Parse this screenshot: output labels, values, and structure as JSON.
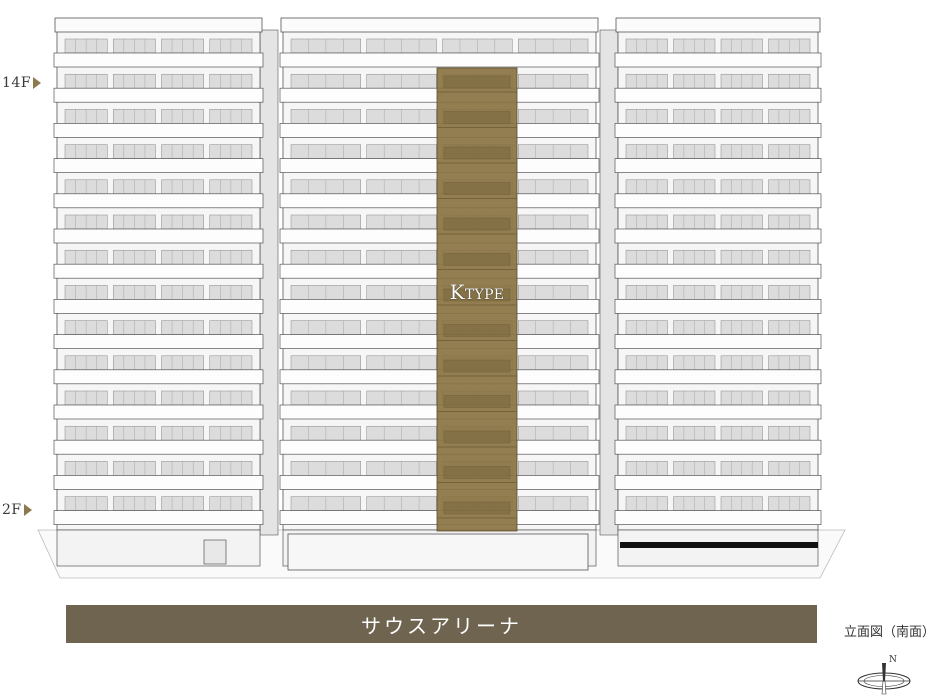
{
  "floor_labels": {
    "top": "14F",
    "bottom": "2F"
  },
  "unit_label": {
    "initial": "K",
    "rest": "TYPE"
  },
  "arena_label": "サウスアリーナ",
  "caption": "立面図（南面）",
  "compass_letter": "N",
  "colors": {
    "highlight": "#8a7343",
    "arena_bar": "#6f6450",
    "arrow": "#8a7a4e",
    "outline": "#555555"
  },
  "icons": {
    "compass": "compass-icon",
    "floor_marker": "triangle-right-icon"
  }
}
